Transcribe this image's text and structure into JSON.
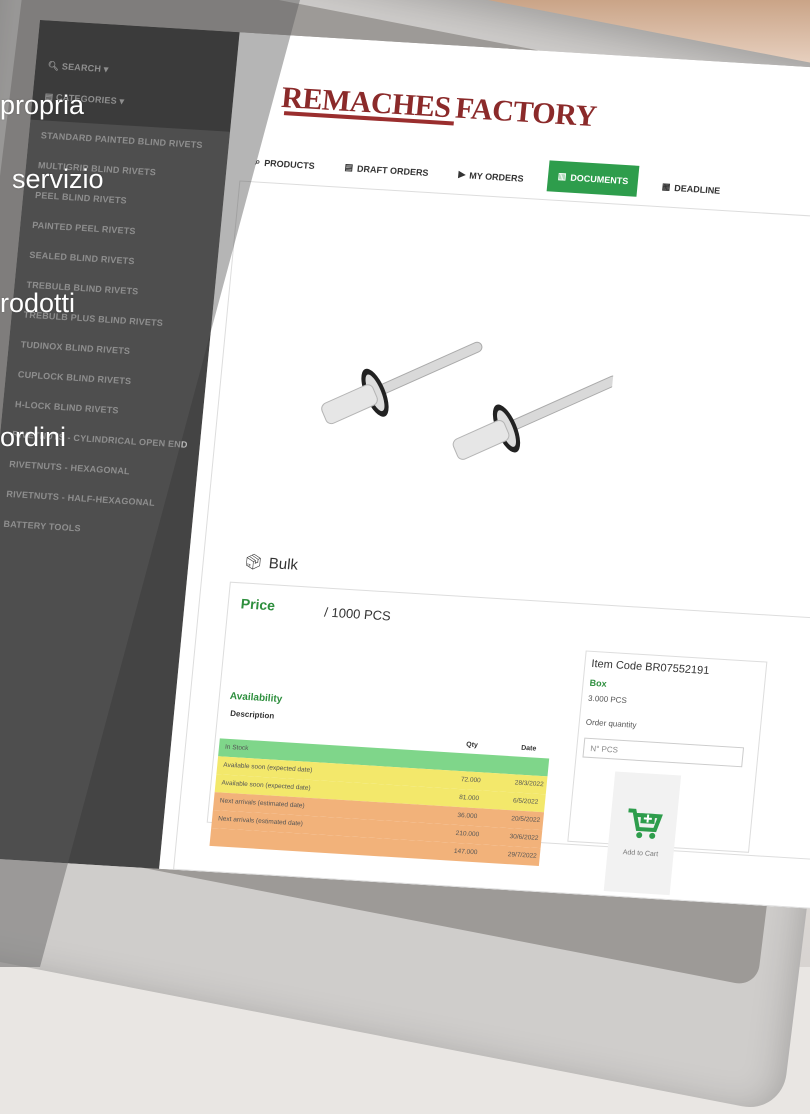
{
  "overlay": {
    "lines": [
      "propria",
      "servizio",
      "rodotti",
      "ordini"
    ]
  },
  "sidebar": {
    "search_label": "SEARCH",
    "categories_label": "CATEGORIES",
    "items": [
      "STANDARD PAINTED BLIND RIVETS",
      "MULTIGRIP BLIND RIVETS",
      "PEEL BLIND RIVETS",
      "PAINTED PEEL RIVETS",
      "SEALED BLIND RIVETS",
      "TREBULB BLIND RIVETS",
      "TREBULB PLUS BLIND RIVETS",
      "TUDINOX BLIND RIVETS",
      "CUPLOCK BLIND RIVETS",
      "H-LOCK BLIND RIVETS",
      "RIVETNUTS - CYLINDRICAL OPEN END",
      "RIVETNUTS - HEXAGONAL",
      "RIVETNUTS - HALF-HEXAGONAL",
      "BATTERY TOOLS"
    ]
  },
  "logo": {
    "part1": "REMACHES",
    "part2": "FACTORY"
  },
  "nav": [
    {
      "label": "PRODUCTS",
      "icon": "search-icon"
    },
    {
      "label": "DRAFT ORDERS",
      "icon": "boxes-icon"
    },
    {
      "label": "MY ORDERS",
      "icon": "truck-icon"
    },
    {
      "label": "DOCUMENTS",
      "icon": "file-icon",
      "active": true
    },
    {
      "label": "DEADLINE",
      "icon": "calendar-icon"
    }
  ],
  "product": {
    "pack_type": "Bulk",
    "price_label": "Price",
    "price_unit": "/ 1000 PCS",
    "availability_label": "Availability",
    "description_label": "Description",
    "qty_label": "Qty",
    "date_label": "Date",
    "rows": [
      {
        "desc": "In Stock",
        "qty": "",
        "date": "",
        "color": "#7fd68a"
      },
      {
        "desc": "Available soon (expected date)",
        "qty": "72.000",
        "date": "28/3/2022",
        "color": "#f3e86b"
      },
      {
        "desc": "Available soon (expected date)",
        "qty": "81.000",
        "date": "6/5/2022",
        "color": "#f3e86b"
      },
      {
        "desc": "Next arrivals (estimated date)",
        "qty": "36.000",
        "date": "20/5/2022",
        "color": "#f2b27a"
      },
      {
        "desc": "Next arrivals (estimated date)",
        "qty": "210.000",
        "date": "30/6/2022",
        "color": "#f2b27a"
      },
      {
        "desc": "",
        "qty": "147.000",
        "date": "29/7/2022",
        "color": "#f2b27a"
      }
    ],
    "item_code": "Item Code BR07552191",
    "box_label": "Box",
    "box_value": "3.000 PCS",
    "order_qty_label": "Order quantity",
    "order_qty_placeholder": "N° PCS",
    "add_to_cart": "Add to Cart"
  },
  "colors": {
    "accent": "#2e9d4c",
    "brand": "#8b2a2a"
  }
}
